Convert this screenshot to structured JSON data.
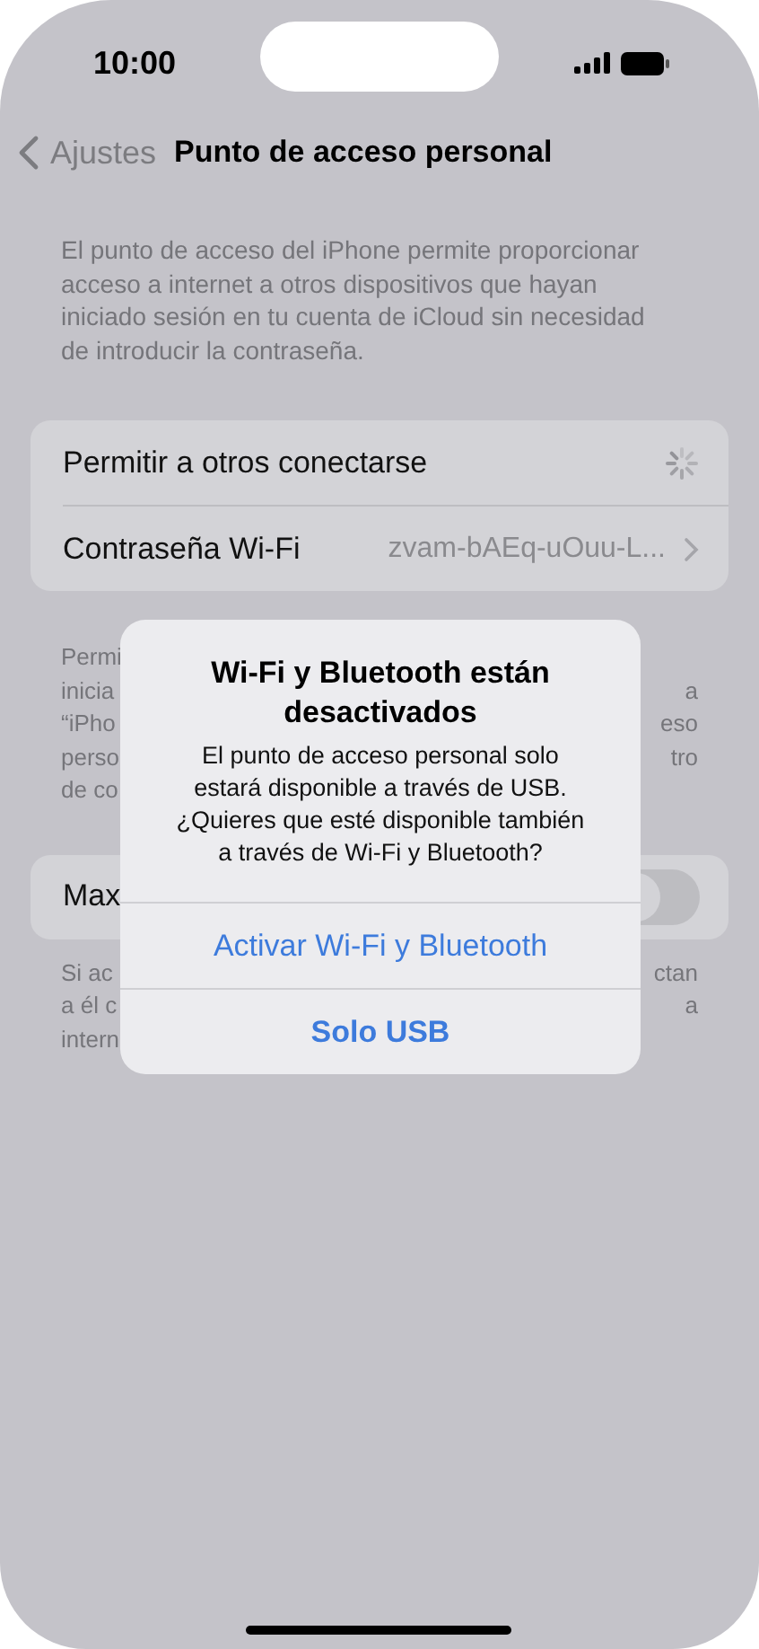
{
  "status_bar": {
    "time": "10:00"
  },
  "nav": {
    "back": "Ajustes",
    "title": "Punto de acceso personal"
  },
  "intro": "El punto de acceso del iPhone permite proporcionar acceso a internet a otros dispositivos que hayan iniciado sesión en tu cuenta de iCloud sin necesidad de introducir la contraseña.",
  "settings": [
    {
      "kind": "spinner",
      "label": "Permitir a otros conectarse"
    },
    {
      "kind": "link",
      "label": "Contraseña Wi-Fi",
      "value": "zvam-bAEq-uOuu-L..."
    }
  ],
  "note_lines": [
    {
      "left": "Permi"
    },
    {
      "left": "inicia",
      "right": "a"
    },
    {
      "left": "“iPho",
      "right": "eso"
    },
    {
      "left": "perso",
      "right": "tro"
    },
    {
      "left": "de co"
    }
  ],
  "max_row": {
    "label": "Max",
    "on": false
  },
  "footer_lines": [
    {
      "left": "Si ac",
      "right": "ctan"
    },
    {
      "left": "a él c",
      "right": "a"
    },
    {
      "left": "intern"
    }
  ],
  "alert": {
    "title": "Wi-Fi y Bluetooth están desactivados",
    "message": "El punto de acceso personal solo estará disponible a través de USB. ¿Quieres que esté disponible también a través de Wi-Fi y Bluetooth?",
    "buttons": [
      {
        "label": "Activar Wi-Fi y Bluetooth",
        "bold": false
      },
      {
        "label": "Solo USB",
        "bold": true
      }
    ]
  }
}
